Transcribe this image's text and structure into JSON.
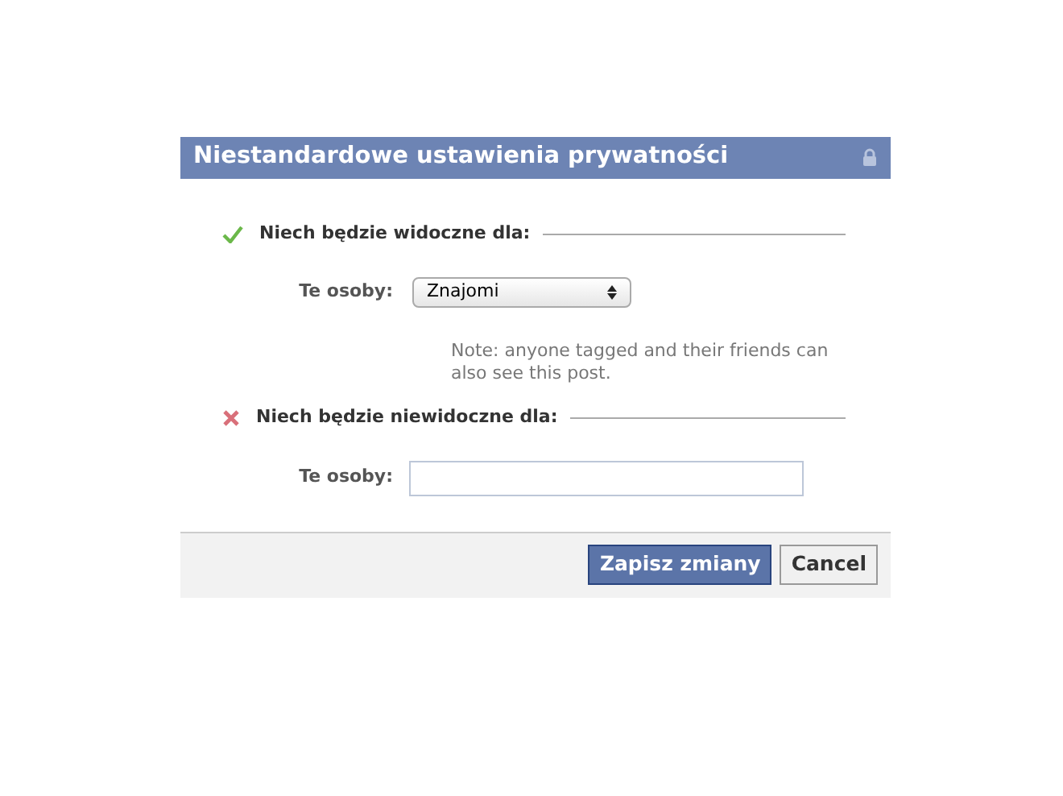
{
  "dialog": {
    "title": "Niestandardowe ustawienia prywatności",
    "locked": true
  },
  "sections": [
    {
      "kind": "allow",
      "heading": "Niech będzie widoczne dla:",
      "field_label": "Te osoby:",
      "field": {
        "kind": "select",
        "value": "Znajomi"
      },
      "note": "Note: anyone tagged and their friends can also see this post."
    },
    {
      "kind": "deny",
      "heading": "Niech będzie niewidoczne dla:",
      "field_label": "Te osoby:",
      "field": {
        "kind": "text"
      }
    }
  ],
  "buttons": [
    {
      "label": "Zapisz zmiany",
      "kind": "primary"
    },
    {
      "label": "Cancel",
      "kind": "secondary"
    }
  ]
}
